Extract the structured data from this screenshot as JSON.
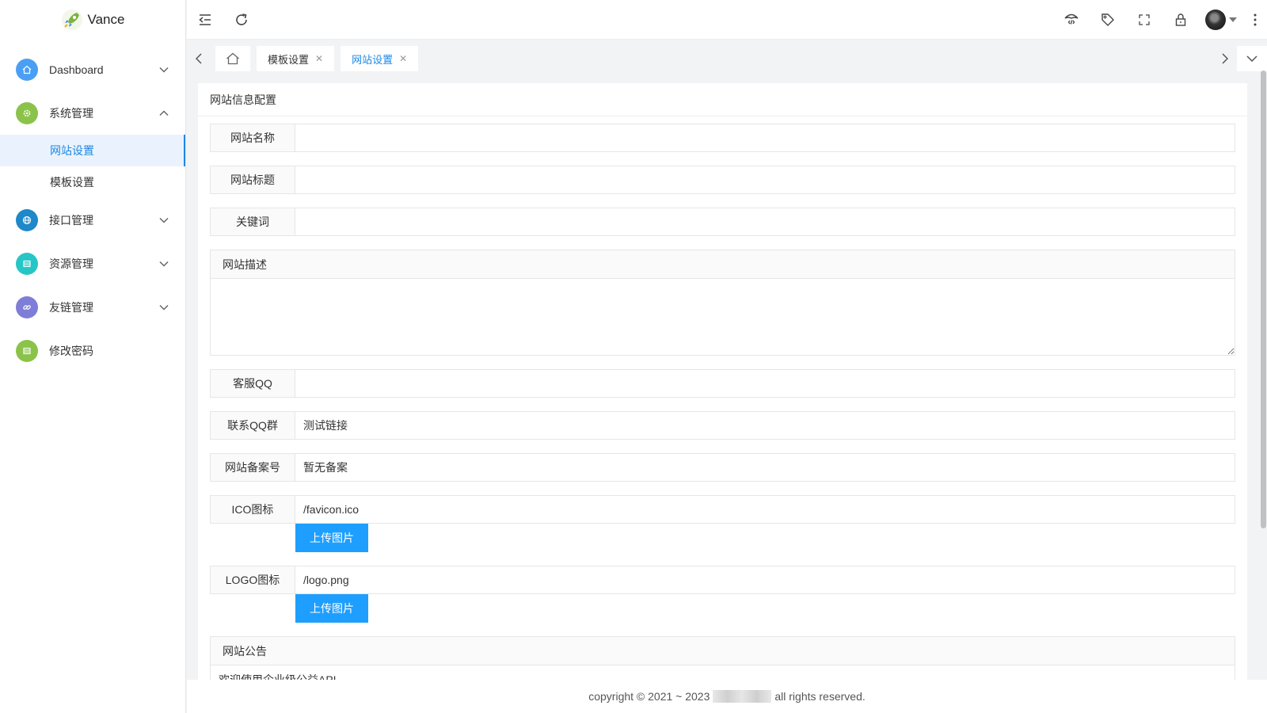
{
  "app": {
    "name": "Vance"
  },
  "colors": {
    "accent": "#1e88e5",
    "button": "#1e9fff"
  },
  "sidebar": {
    "items": [
      {
        "label": "Dashboard",
        "icon": "home-icon",
        "color": "#4a9ff5",
        "expanded": false
      },
      {
        "label": "系统管理",
        "icon": "gear-icon",
        "color": "#8bc34a",
        "expanded": true,
        "children": [
          {
            "label": "网站设置",
            "active": true
          },
          {
            "label": "模板设置",
            "active": false
          }
        ]
      },
      {
        "label": "接口管理",
        "icon": "globe-icon",
        "color": "#1e88c8",
        "expanded": false
      },
      {
        "label": "资源管理",
        "icon": "list-icon",
        "color": "#26c6c6",
        "expanded": false
      },
      {
        "label": "友链管理",
        "icon": "link-icon",
        "color": "#7e7ed8",
        "expanded": false
      },
      {
        "label": "修改密码",
        "icon": "list-icon",
        "color": "#8bc34a",
        "expanded": false
      }
    ]
  },
  "tabs": [
    {
      "label": "模板设置",
      "active": false
    },
    {
      "label": "网站设置",
      "active": true
    }
  ],
  "card": {
    "title": "网站信息配置"
  },
  "form": {
    "site_name": {
      "label": "网站名称",
      "value": ""
    },
    "site_title": {
      "label": "网站标题",
      "value": ""
    },
    "keywords": {
      "label": "关键词",
      "value": ""
    },
    "description": {
      "label": "网站描述",
      "value": ""
    },
    "qq": {
      "label": "客服QQ",
      "value": ""
    },
    "qq_group": {
      "label": "联系QQ群",
      "value": "测试链接"
    },
    "icp": {
      "label": "网站备案号",
      "value": "暂无备案"
    },
    "ico": {
      "label": "ICO图标",
      "value": "/favicon.ico",
      "button": "上传图片"
    },
    "logo": {
      "label": "LOGO图标",
      "value": "/logo.png",
      "button": "上传图片"
    },
    "notice": {
      "label": "网站公告",
      "value": "欢迎使用企业级公益API"
    }
  },
  "footer": {
    "prefix": "copyright © 2021 ~ 2023",
    "suffix": "all rights reserved."
  }
}
